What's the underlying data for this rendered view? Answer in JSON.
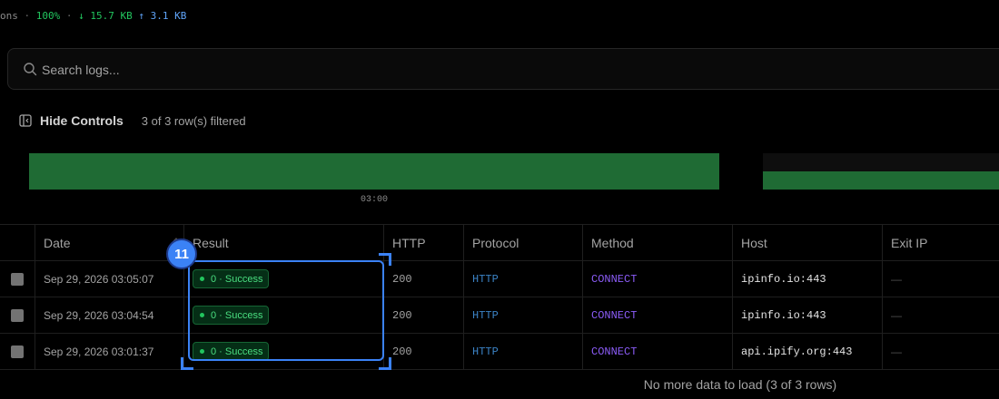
{
  "stats": {
    "prefix": "ons",
    "sep1": "·",
    "percent": "100%",
    "sep2": "·",
    "down": "↓ 15.7 KB",
    "up": "↑ 3.1 KB"
  },
  "search": {
    "placeholder": "Search logs..."
  },
  "controls": {
    "hide_label": "Hide Controls",
    "filtered_text": "3 of 3 row(s) filtered"
  },
  "timeline": {
    "tick_label": "03:00",
    "bar_color": "#1f6b34"
  },
  "table": {
    "headers": {
      "date": "Date",
      "result": "Result",
      "http": "HTTP",
      "protocol": "Protocol",
      "method": "Method",
      "host": "Host",
      "exit_ip": "Exit IP"
    },
    "rows": [
      {
        "date": "Sep 29, 2026 03:05:07",
        "result": "0 · Success",
        "http": "200",
        "protocol": "HTTP",
        "method": "CONNECT",
        "host": "ipinfo.io:443",
        "exit_ip": "—"
      },
      {
        "date": "Sep 29, 2026 03:04:54",
        "result": "0 · Success",
        "http": "200",
        "protocol": "HTTP",
        "method": "CONNECT",
        "host": "ipinfo.io:443",
        "exit_ip": "—"
      },
      {
        "date": "Sep 29, 2026 03:01:37",
        "result": "0 · Success",
        "http": "200",
        "protocol": "HTTP",
        "method": "CONNECT",
        "host": "api.ipify.org:443",
        "exit_ip": "—"
      }
    ]
  },
  "annotation": {
    "marker_label": "11",
    "color": "#3b82f6"
  },
  "footer": {
    "text": "No more data to load (3 of 3 rows)"
  },
  "icons": {
    "search": "search-icon",
    "panel_toggle": "panel-left-icon",
    "sort": "sort-icon"
  }
}
